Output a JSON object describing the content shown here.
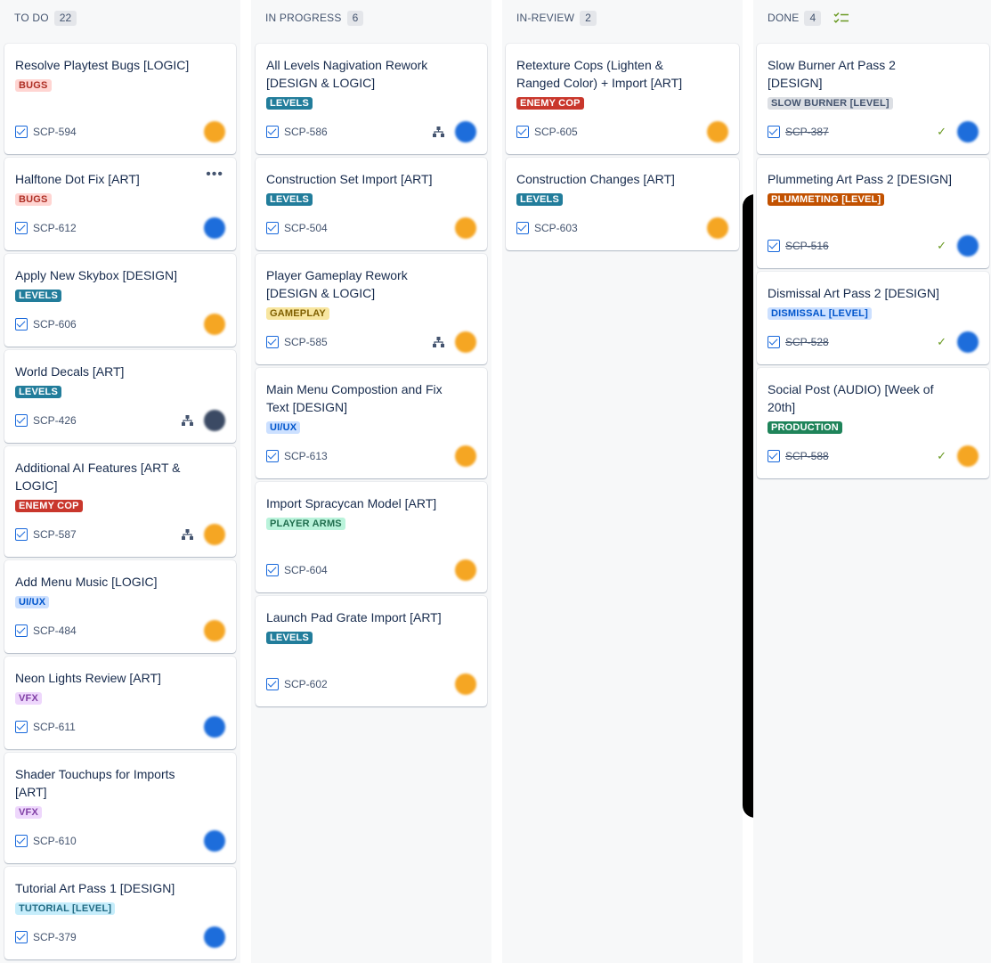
{
  "colors": {
    "bugs_bg": "#ffd5d2",
    "bugs_fg": "#ae2e24",
    "levels_bg": "#227d9b",
    "levels_fg": "#ffffff",
    "enemy_bg": "#c9372c",
    "enemy_fg": "#ffffff",
    "uiux_bg": "#cce0ff",
    "uiux_fg": "#0055cc",
    "vfx_bg": "#eed7fc",
    "vfx_fg": "#803fa5",
    "tutorial_bg": "#c6edfb",
    "tutorial_fg": "#206a83",
    "gameplay_bg": "#f8e6a0",
    "gameplay_fg": "#7f5f01",
    "arms_bg": "#baf3db",
    "arms_fg": "#216e4e",
    "slow_bg": "#dcdfe4",
    "slow_fg": "#44546f",
    "plummet_bg": "#c25100",
    "plummet_fg": "#ffffff",
    "dismissal_bg": "#cce0ff",
    "dismissal_fg": "#0055cc",
    "production_bg": "#1f845a",
    "production_fg": "#ffffff",
    "avatar_orange": "#f5a623",
    "avatar_blue": "#1d6ddb",
    "avatar_dark": "#3b4a64"
  },
  "columns": [
    {
      "title": "TO DO",
      "count": "22",
      "cards": [
        {
          "title": "Resolve Playtest Bugs [LOGIC]",
          "label": "BUGS",
          "key": "SCP-594",
          "avatar": "orange"
        },
        {
          "title": "Halftone Dot Fix [ART]",
          "label": "BUGS",
          "key": "SCP-612",
          "avatar": "blue",
          "more": "•••"
        },
        {
          "title": "Apply New Skybox [DESIGN]",
          "label": "LEVELS",
          "key": "SCP-606",
          "avatar": "orange"
        },
        {
          "title": "World Decals [ART]",
          "label": "LEVELS",
          "key": "SCP-426",
          "avatar": "dark"
        },
        {
          "title": "Additional AI Features [ART & LOGIC]",
          "label": "ENEMY COP",
          "key": "SCP-587",
          "avatar": "orange"
        },
        {
          "title": "Add Menu Music [LOGIC]",
          "label": "UI/UX",
          "key": "SCP-484",
          "avatar": "orange"
        },
        {
          "title": "Neon Lights Review [ART]",
          "label": "VFX",
          "key": "SCP-611",
          "avatar": "blue"
        },
        {
          "title": "Shader Touchups for Imports [ART]",
          "label": "VFX",
          "key": "SCP-610",
          "avatar": "blue"
        },
        {
          "title": "Tutorial Art Pass 1 [DESIGN]",
          "label": "TUTORIAL [LEVEL]",
          "key": "SCP-379",
          "avatar": "blue"
        }
      ]
    },
    {
      "title": "IN PROGRESS",
      "count": "6",
      "cards": [
        {
          "title": "All Levels Nagivation Rework [DESIGN & LOGIC]",
          "label": "LEVELS",
          "key": "SCP-586",
          "avatar": "blue"
        },
        {
          "title": "Construction Set Import [ART]",
          "label": "LEVELS",
          "key": "SCP-504",
          "avatar": "orange"
        },
        {
          "title": "Player Gameplay Rework [DESIGN & LOGIC]",
          "label": "GAMEPLAY",
          "key": "SCP-585",
          "avatar": "orange"
        },
        {
          "title": "Main Menu Compostion and Fix Text [DESIGN]",
          "label": "UI/UX",
          "key": "SCP-613",
          "avatar": "orange"
        },
        {
          "title": "Import Spracycan Model [ART]",
          "label": "PLAYER ARMS",
          "key": "SCP-604",
          "avatar": "orange"
        },
        {
          "title": "Launch Pad Grate Import [ART]",
          "label": "LEVELS",
          "key": "SCP-602",
          "avatar": "orange"
        }
      ]
    },
    {
      "title": "IN-REVIEW",
      "count": "2",
      "cards": [
        {
          "title": "Retexture Cops (Lighten & Ranged Color) + Import [ART]",
          "label": "ENEMY COP",
          "key": "SCP-605",
          "avatar": "orange"
        },
        {
          "title": "Construction Changes [ART]",
          "label": "LEVELS",
          "key": "SCP-603",
          "avatar": "orange"
        }
      ]
    },
    {
      "title": "DONE",
      "count": "4",
      "cards": [
        {
          "title": "Slow Burner Art Pass 2 [DESIGN]",
          "label": "SLOW BURNER [LEVEL]",
          "key": "SCP-387",
          "avatar": "blue"
        },
        {
          "title": "Plummeting Art Pass 2 [DESIGN]",
          "label": "PLUMMETING [LEVEL]",
          "key": "SCP-516",
          "avatar": "blue"
        },
        {
          "title": "Dismissal Art Pass 2 [DESIGN]",
          "label": "DISMISSAL [LEVEL]",
          "key": "SCP-528",
          "avatar": "blue"
        },
        {
          "title": "Social Post (AUDIO) [Week of 20th]",
          "label": "PRODUCTION",
          "key": "SCP-588",
          "avatar": "orange"
        }
      ]
    }
  ]
}
